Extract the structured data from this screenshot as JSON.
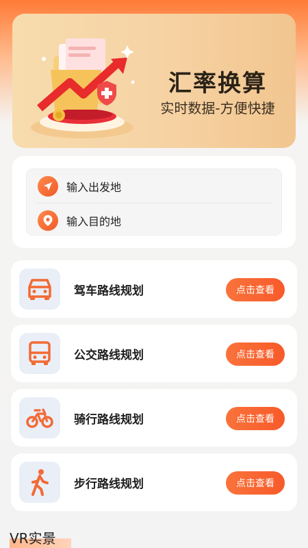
{
  "banner": {
    "title": "汇率换算",
    "subtitle": "实时数据-方便快捷",
    "illustration": "finance-growth-illustration"
  },
  "location": {
    "origin_placeholder": "输入出发地",
    "origin_icon": "navigation-arrow-icon",
    "destination_placeholder": "输入目的地",
    "destination_icon": "map-pin-icon"
  },
  "routes": [
    {
      "label": "驾车路线规划",
      "icon": "car-icon",
      "button": "点击查看"
    },
    {
      "label": "公交路线规划",
      "icon": "bus-icon",
      "button": "点击查看"
    },
    {
      "label": "骑行路线规划",
      "icon": "bicycle-icon",
      "button": "点击查看"
    },
    {
      "label": "步行路线规划",
      "icon": "walking-icon",
      "button": "点击查看"
    }
  ],
  "section": {
    "title": "VR实景"
  },
  "colors": {
    "accent": "#f85a2a",
    "header_gradient_top": "#ff7a36",
    "banner_bg": "#f6d2a3",
    "icon_box_bg": "#e9eef7"
  }
}
